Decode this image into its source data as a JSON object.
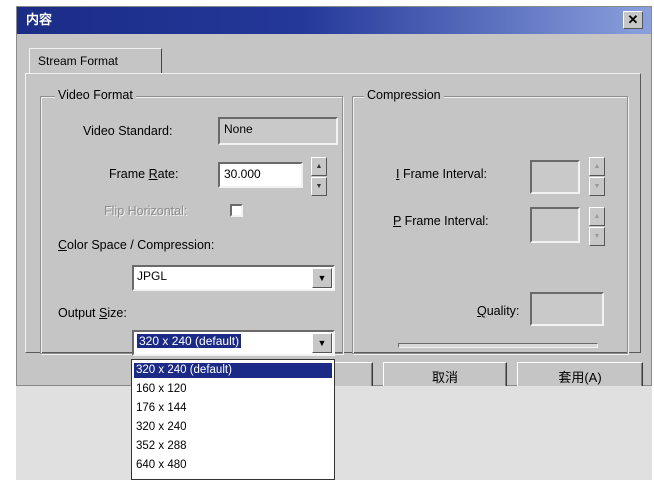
{
  "window": {
    "title": "内容",
    "close_glyph": "✕"
  },
  "tabs": [
    {
      "label": "Stream Format"
    }
  ],
  "video_format": {
    "group_label": "Video Format",
    "video_standard_label": "Video Standard:",
    "video_standard_value": "None",
    "frame_rate_label_pre": "Frame ",
    "frame_rate_label_ul": "R",
    "frame_rate_label_post": "ate:",
    "frame_rate_value": "30.000",
    "flip_label": "Flip Horizontal:",
    "color_space_label_ul": "C",
    "color_space_label_rest": "olor Space / Compression:",
    "color_space_value": "JPGL",
    "output_size_label_pre": "Output ",
    "output_size_label_ul": "S",
    "output_size_label_post": "ize:",
    "output_size_value": "320 x 240  (default)"
  },
  "compression": {
    "group_label": "Compression",
    "i_frame_label_ul": "I",
    "i_frame_label_rest": " Frame Interval:",
    "p_frame_label_ul": "P",
    "p_frame_label_rest": " Frame Interval:",
    "quality_label_ul": "Q",
    "quality_label_rest": "uality:"
  },
  "output_size_options": [
    "320 x 240  (default)",
    "160 x 120",
    "176 x 144",
    "320 x 240",
    "352 x 288",
    "640 x 480"
  ],
  "buttons": {
    "cancel": "取消",
    "apply": "套用(A)"
  },
  "icons": {
    "spin_up": "▲",
    "spin_down": "▼",
    "dropdown": "▼"
  }
}
